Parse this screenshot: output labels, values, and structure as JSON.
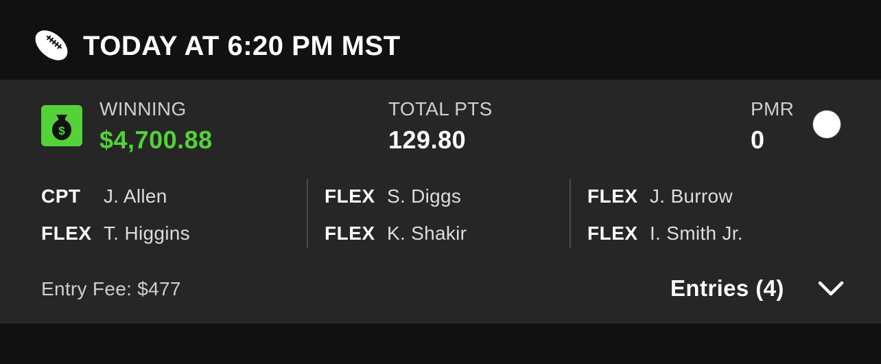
{
  "header": {
    "icon": "football-icon",
    "title": "TODAY AT 6:20 PM MST"
  },
  "summary": {
    "money_icon": "money-bag-icon",
    "winning_label": "WINNING",
    "winning_value": "$4,700.88",
    "winning_color": "#53d337",
    "total_label": "TOTAL PTS",
    "total_value": "129.80",
    "pmr_label": "PMR",
    "pmr_value": "0"
  },
  "lineup": [
    [
      {
        "pos": "CPT",
        "player": "J. Allen"
      },
      {
        "pos": "FLEX",
        "player": "T. Higgins"
      }
    ],
    [
      {
        "pos": "FLEX",
        "player": "S. Diggs"
      },
      {
        "pos": "FLEX",
        "player": "K. Shakir"
      }
    ],
    [
      {
        "pos": "FLEX",
        "player": "J. Burrow"
      },
      {
        "pos": "FLEX",
        "player": "I. Smith Jr."
      }
    ]
  ],
  "footer": {
    "entry_fee": "Entry Fee: $477",
    "entries_label": "Entries (4)",
    "entries_icon": "chevron-down-icon"
  }
}
